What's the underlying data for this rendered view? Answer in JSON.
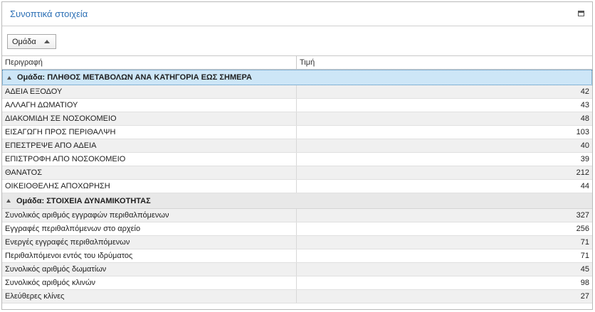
{
  "panel": {
    "title": "Συνοπτικά στοιχεία"
  },
  "groupby": {
    "chip_label": "Ομάδα"
  },
  "grid": {
    "columns": [
      "Περιγραφή",
      "Τιμή"
    ],
    "groups": [
      {
        "label": "Ομάδα: ΠΛΗΘΟΣ ΜΕΤΑΒΟΛΩΝ ΑΝΑ ΚΑΤΗΓΟΡΙΑ ΕΩΣ ΣΗΜΕΡΑ",
        "selected": true,
        "rows": [
          {
            "desc": "ΑΔΕΙΑ ΕΞΟΔΟΥ",
            "value": "42"
          },
          {
            "desc": "ΑΛΛΑΓΗ ΔΩΜΑΤΙΟΥ",
            "value": "43"
          },
          {
            "desc": "ΔΙΑΚΟΜΙΔΗ ΣΕ ΝΟΣΟΚΟΜΕΙΟ",
            "value": "48"
          },
          {
            "desc": "ΕΙΣΑΓΩΓΗ ΠΡΟΣ ΠΕΡΙΘΑΛΨΗ",
            "value": "103"
          },
          {
            "desc": "ΕΠΕΣΤΡΕΨΕ ΑΠΟ ΑΔΕΙΑ",
            "value": "40"
          },
          {
            "desc": "ΕΠΙΣΤΡΟΦΗ ΑΠΟ ΝΟΣΟΚΟΜΕΙΟ",
            "value": "39"
          },
          {
            "desc": "ΘΑΝΑΤΟΣ",
            "value": "212"
          },
          {
            "desc": "ΟΙΚΕΙΟΘΕΛΗΣ ΑΠΟΧΩΡΗΣΗ",
            "value": "44"
          }
        ]
      },
      {
        "label": "Ομάδα: ΣΤΟΙΧΕΙΑ ΔΥΝΑΜΙΚΟΤΗΤΑΣ",
        "selected": false,
        "rows": [
          {
            "desc": "Συνολικός αριθμός εγγραφών περιθαλπόμενων",
            "value": "327"
          },
          {
            "desc": "Εγγραφές περιθαλπόμενων στο αρχείο",
            "value": "256"
          },
          {
            "desc": "Ενεργές εγγραφές περιθαλπόμενων",
            "value": "71"
          },
          {
            "desc": "Περιθαλπόμενοι εντός του ιδρύματος",
            "value": "71"
          },
          {
            "desc": "Συνολικός αριθμός δωματίων",
            "value": "45"
          },
          {
            "desc": "Συνολικός αριθμός κλινών",
            "value": "98"
          },
          {
            "desc": "Ελεύθερες κλίνες",
            "value": "27"
          }
        ]
      }
    ]
  },
  "colors": {
    "title": "#2b6fb5",
    "selected_group_bg": "#cde6f7",
    "group_bg": "#e8e8e8",
    "alt_row_bg": "#f0f0f0"
  },
  "icons": {
    "minimize": "minimize-icon",
    "sort": "sort-up-icon",
    "collapse": "collapse-icon"
  }
}
